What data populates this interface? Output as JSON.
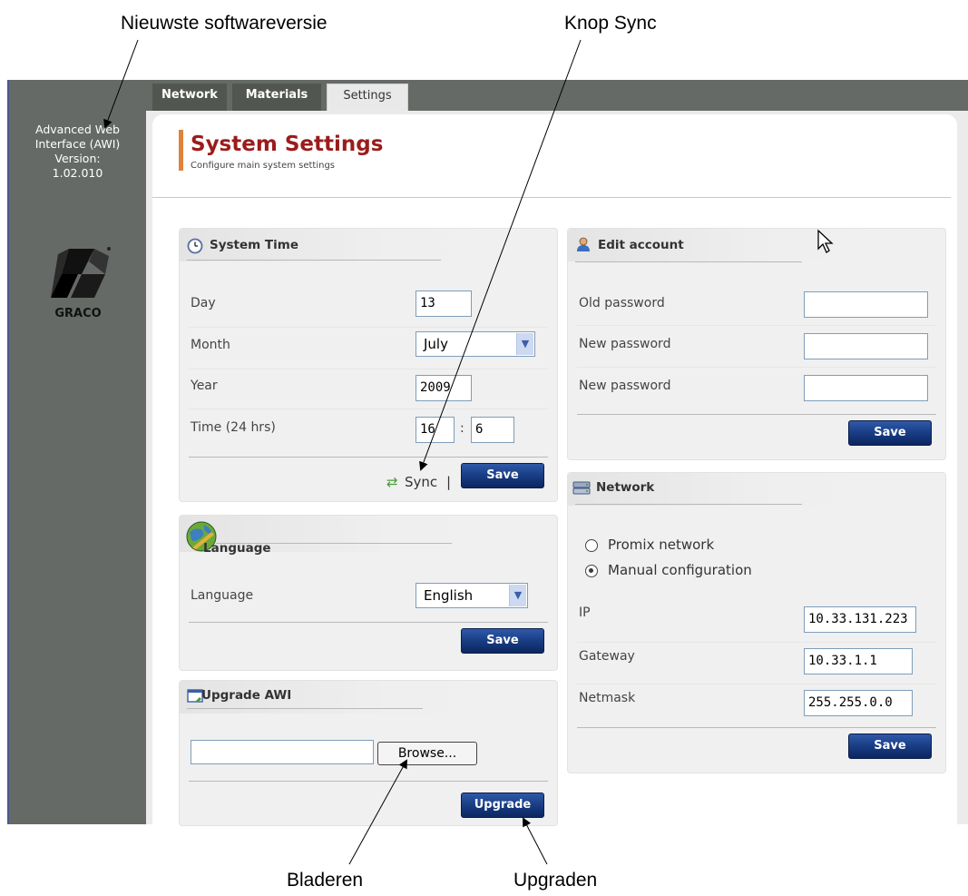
{
  "callouts": {
    "latest_version": "Nieuwste softwareversie",
    "sync_button": "Knop Sync",
    "browse": "Bladeren",
    "upgrade": "Upgraden"
  },
  "sidebar": {
    "version_lines": [
      "Advanced Web",
      "Interface (AWI)",
      "Version:",
      "1.02.010"
    ],
    "logo_text": "GRACO"
  },
  "tabs": [
    {
      "label": "Network",
      "active": false
    },
    {
      "label": "Materials",
      "active": false
    },
    {
      "label": "Settings",
      "active": true
    }
  ],
  "page": {
    "title": "System Settings",
    "subtitle": "Configure main system settings"
  },
  "system_time": {
    "title": "System Time",
    "day_label": "Day",
    "day_value": "13",
    "month_label": "Month",
    "month_value": "July",
    "year_label": "Year",
    "year_value": "2009",
    "time_label": "Time (24 hrs)",
    "hour_value": "16",
    "time_sep": ":",
    "minute_value": "6",
    "sync_label": "Sync",
    "sync_suffix": "|",
    "save_label": "Save"
  },
  "language": {
    "title": "Language",
    "language_label": "Language",
    "language_value": "English",
    "save_label": "Save"
  },
  "upgrade": {
    "title": "Upgrade AWI",
    "file_value": "",
    "browse_label": "Browse...",
    "upgrade_label": "Upgrade"
  },
  "edit_account": {
    "title": "Edit account",
    "old_password_label": "Old password",
    "new_password_label": "New password",
    "confirm_password_label": "New password",
    "save_label": "Save"
  },
  "network": {
    "title": "Network",
    "option_promix": "Promix network",
    "option_manual": "Manual configuration",
    "selected": "Manual configuration",
    "ip_label": "IP",
    "ip_value": "10.33.131.223",
    "gateway_label": "Gateway",
    "gateway_value": "10.33.1.1",
    "netmask_label": "Netmask",
    "netmask_value": "255.255.0.0",
    "save_label": "Save"
  },
  "colors": {
    "sidebar": "#666a66",
    "title": "#9b1b1b",
    "accent": "#e0823a",
    "button": "#173a80"
  }
}
